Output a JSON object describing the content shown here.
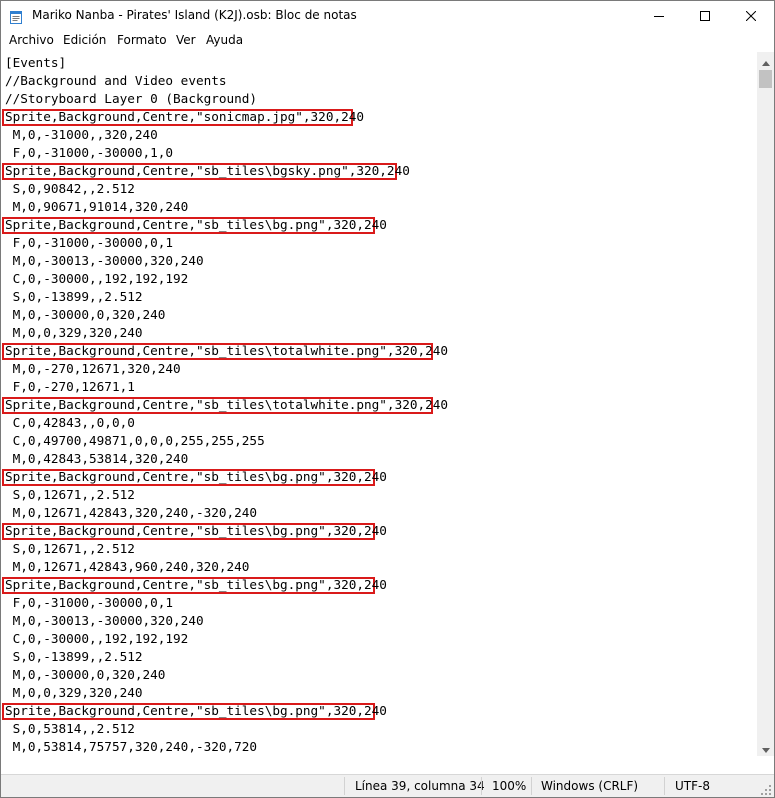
{
  "window": {
    "title": "Mariko Nanba - Pirates' Island (K2J).osb: Bloc de notas",
    "icon": "notepad-icon",
    "controls": [
      "minimize-icon",
      "maximize-icon",
      "close-icon"
    ]
  },
  "menu": {
    "items": [
      {
        "label": "Archivo"
      },
      {
        "label": "Edición"
      },
      {
        "label": "Formato"
      },
      {
        "label": "Ver"
      },
      {
        "label": "Ayuda"
      }
    ]
  },
  "editor": {
    "highlight_color": "#d91a1a",
    "lines": [
      {
        "text": "[Events]",
        "highlighted": false
      },
      {
        "text": "//Background and Video events",
        "highlighted": false
      },
      {
        "text": "//Storyboard Layer 0 (Background)",
        "highlighted": false
      },
      {
        "text": "Sprite,Background,Centre,\"sonicmap.jpg\",320,240",
        "highlighted": true
      },
      {
        "text": " M,0,-31000,,320,240",
        "highlighted": false
      },
      {
        "text": " F,0,-31000,-30000,1,0",
        "highlighted": false
      },
      {
        "text": "Sprite,Background,Centre,\"sb_tiles\\bgsky.png\",320,240",
        "highlighted": true
      },
      {
        "text": " S,0,90842,,2.512",
        "highlighted": false
      },
      {
        "text": " M,0,90671,91014,320,240",
        "highlighted": false
      },
      {
        "text": "Sprite,Background,Centre,\"sb_tiles\\bg.png\",320,240",
        "highlighted": true
      },
      {
        "text": " F,0,-31000,-30000,0,1",
        "highlighted": false
      },
      {
        "text": " M,0,-30013,-30000,320,240",
        "highlighted": false
      },
      {
        "text": " C,0,-30000,,192,192,192",
        "highlighted": false
      },
      {
        "text": " S,0,-13899,,2.512",
        "highlighted": false
      },
      {
        "text": " M,0,-30000,0,320,240",
        "highlighted": false
      },
      {
        "text": " M,0,0,329,320,240",
        "highlighted": false
      },
      {
        "text": "Sprite,Background,Centre,\"sb_tiles\\totalwhite.png\",320,240",
        "highlighted": true
      },
      {
        "text": " M,0,-270,12671,320,240",
        "highlighted": false
      },
      {
        "text": " F,0,-270,12671,1",
        "highlighted": false
      },
      {
        "text": "Sprite,Background,Centre,\"sb_tiles\\totalwhite.png\",320,240",
        "highlighted": true
      },
      {
        "text": " C,0,42843,,0,0,0",
        "highlighted": false
      },
      {
        "text": " C,0,49700,49871,0,0,0,255,255,255",
        "highlighted": false
      },
      {
        "text": " M,0,42843,53814,320,240",
        "highlighted": false
      },
      {
        "text": "Sprite,Background,Centre,\"sb_tiles\\bg.png\",320,240",
        "highlighted": true
      },
      {
        "text": " S,0,12671,,2.512",
        "highlighted": false
      },
      {
        "text": " M,0,12671,42843,320,240,-320,240",
        "highlighted": false
      },
      {
        "text": "Sprite,Background,Centre,\"sb_tiles\\bg.png\",320,240",
        "highlighted": true
      },
      {
        "text": " S,0,12671,,2.512",
        "highlighted": false
      },
      {
        "text": " M,0,12671,42843,960,240,320,240",
        "highlighted": false
      },
      {
        "text": "Sprite,Background,Centre,\"sb_tiles\\bg.png\",320,240",
        "highlighted": true
      },
      {
        "text": " F,0,-31000,-30000,0,1",
        "highlighted": false
      },
      {
        "text": " M,0,-30013,-30000,320,240",
        "highlighted": false
      },
      {
        "text": " C,0,-30000,,192,192,192",
        "highlighted": false
      },
      {
        "text": " S,0,-13899,,2.512",
        "highlighted": false
      },
      {
        "text": " M,0,-30000,0,320,240",
        "highlighted": false
      },
      {
        "text": " M,0,0,329,320,240",
        "highlighted": false
      },
      {
        "text": "Sprite,Background,Centre,\"sb_tiles\\bg.png\",320,240",
        "highlighted": true
      },
      {
        "text": " S,0,53814,,2.512",
        "highlighted": false
      },
      {
        "text": " M,0,53814,75757,320,240,-320,720",
        "highlighted": false
      }
    ]
  },
  "status": {
    "position": "Línea 39, columna 34",
    "zoom": "100%",
    "line_ending": "Windows (CRLF)",
    "encoding": "UTF-8"
  }
}
